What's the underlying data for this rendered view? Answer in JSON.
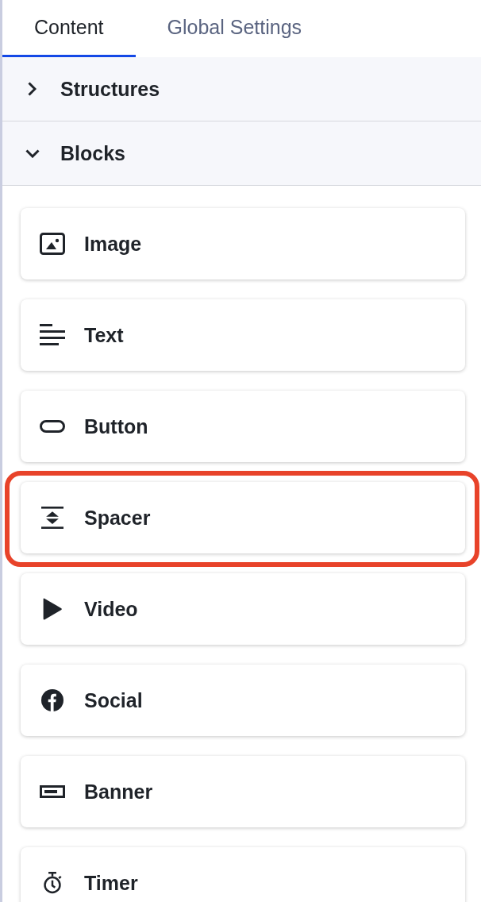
{
  "tabs": [
    {
      "label": "Content",
      "selected": true
    },
    {
      "label": "Global Settings",
      "selected": false
    }
  ],
  "sections": [
    {
      "title": "Structures",
      "expanded": false
    },
    {
      "title": "Blocks",
      "expanded": true,
      "items": [
        {
          "label": "Image",
          "kind": "image",
          "highlighted": false
        },
        {
          "label": "Text",
          "kind": "text",
          "highlighted": false
        },
        {
          "label": "Button",
          "kind": "button",
          "highlighted": false
        },
        {
          "label": "Spacer",
          "kind": "spacer",
          "highlighted": true
        },
        {
          "label": "Video",
          "kind": "video",
          "highlighted": false
        },
        {
          "label": "Social",
          "kind": "social",
          "highlighted": false
        },
        {
          "label": "Banner",
          "kind": "banner",
          "highlighted": false
        },
        {
          "label": "Timer",
          "kind": "timer",
          "highlighted": false
        }
      ]
    }
  ]
}
